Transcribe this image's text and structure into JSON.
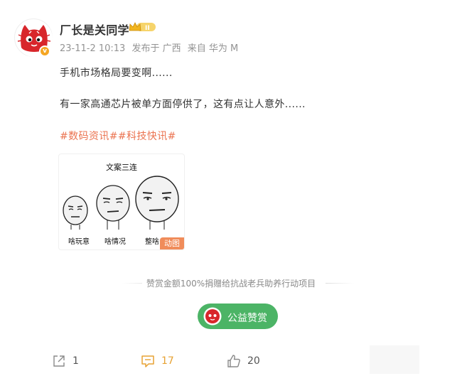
{
  "author": {
    "name": "厂长是关同学",
    "level_badge": "II",
    "verified_badge": "v"
  },
  "meta": {
    "time": "23-11-2 10:13",
    "location": "发布于 广西",
    "source": "来自 华为 M"
  },
  "post": {
    "line1": "手机市场格局要变啊......",
    "line2": "有一家高通芯片被单方面停供了，这有点让人意外......",
    "topics": [
      "#数码资讯#",
      "#科技快讯#"
    ]
  },
  "image": {
    "title": "文案三连",
    "captions": [
      "啥玩意",
      "啥情况",
      "整啥"
    ],
    "gif_label": "动图"
  },
  "reward": {
    "note": "赞赏金额100%捐赠给抗战老兵助养行动项目",
    "button_label": "公益赞赏"
  },
  "actions": {
    "repost_count": "1",
    "comment_count": "17",
    "like_count": "20"
  },
  "colors": {
    "topic": "#eb7350",
    "reward_button": "#4cb466",
    "comment_active": "#e7a233",
    "avatar_red": "#d8262b"
  }
}
